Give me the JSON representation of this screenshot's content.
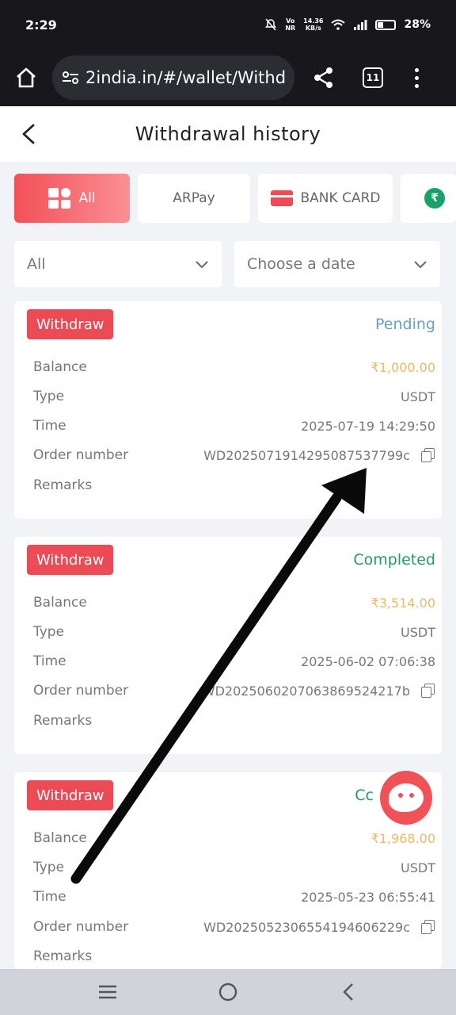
{
  "status_bar": {
    "time": "2:29",
    "speed_value": "14.36",
    "speed_unit": "KB/s",
    "battery": "28%"
  },
  "browser": {
    "url": "2india.in/#/wallet/Withd",
    "tab_count": "11"
  },
  "header": {
    "title": "Withdrawal history"
  },
  "tabs": [
    {
      "label": "All",
      "active": true
    },
    {
      "label": "ARPay",
      "active": false
    },
    {
      "label": "BANK CARD",
      "active": false
    },
    {
      "label": "",
      "icon": "rupee-coin-icon",
      "active": false
    }
  ],
  "filters": {
    "type": "All",
    "date": "Choose a date"
  },
  "labels": {
    "balance": "Balance",
    "type": "Type",
    "time": "Time",
    "order_number": "Order number",
    "remarks": "Remarks"
  },
  "records": [
    {
      "badge": "Withdraw",
      "status": "Pending",
      "balance": "₹1,000.00",
      "type": "USDT",
      "time": "2025-07-19 14:29:50",
      "order_number": "WD2025071914295087537799c",
      "remarks": ""
    },
    {
      "badge": "Withdraw",
      "status": "Completed",
      "balance": "₹3,514.00",
      "type": "USDT",
      "time": "2025-06-02 07:06:38",
      "order_number": "WD2025060207063869524217b",
      "remarks": ""
    },
    {
      "badge": "Withdraw",
      "status": "Cc",
      "balance": "₹1,968.00",
      "type": "USDT",
      "time": "2025-05-23 06:55:41",
      "order_number": "WD2025052306554194606229c",
      "remarks": ""
    }
  ],
  "colors": {
    "accent": "#ec4a54",
    "pending": "#6a9fbe",
    "completed": "#1f9a6b",
    "amount": "#e9ba68"
  }
}
